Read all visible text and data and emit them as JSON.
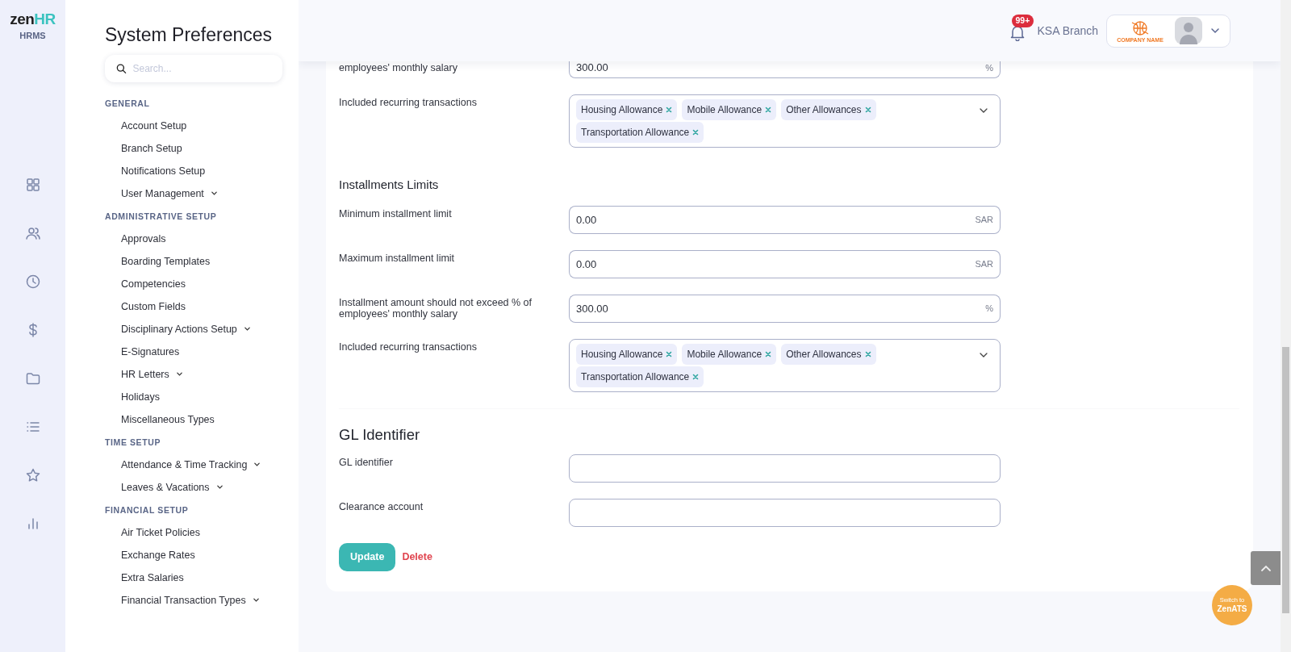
{
  "logo": {
    "parts": [
      {
        "text": "zen",
        "color": "#1f1f1f"
      },
      {
        "text": "HR",
        "color": "#3cc3c0"
      }
    ],
    "subtitle": "HRMS"
  },
  "rail": {
    "items": [
      {
        "kind": "grid"
      },
      {
        "kind": "users"
      },
      {
        "kind": "clock"
      },
      {
        "kind": "dollar"
      },
      {
        "kind": "folder"
      },
      {
        "kind": "list"
      },
      {
        "kind": "star"
      },
      {
        "kind": "chart"
      }
    ]
  },
  "sidebar": {
    "title": "System Preferences",
    "search": {
      "placeholder": "Search..."
    },
    "groups": [
      {
        "title": "GENERAL",
        "items": [
          {
            "label": "Account Setup",
            "has_submenu": false
          },
          {
            "label": "Branch Setup",
            "has_submenu": false
          },
          {
            "label": "Notifications Setup",
            "has_submenu": false
          },
          {
            "label": "User Management",
            "has_submenu": true
          }
        ]
      },
      {
        "title": "ADMINISTRATIVE SETUP",
        "items": [
          {
            "label": "Approvals",
            "has_submenu": false
          },
          {
            "label": "Boarding Templates",
            "has_submenu": false
          },
          {
            "label": "Competencies",
            "has_submenu": false
          },
          {
            "label": "Custom Fields",
            "has_submenu": false
          },
          {
            "label": "Disciplinary Actions Setup",
            "has_submenu": true
          },
          {
            "label": "E-Signatures",
            "has_submenu": false
          },
          {
            "label": "HR Letters",
            "has_submenu": true
          },
          {
            "label": "Holidays",
            "has_submenu": false
          },
          {
            "label": "Miscellaneous Types",
            "has_submenu": false
          }
        ]
      },
      {
        "title": "TIME SETUP",
        "items": [
          {
            "label": "Attendance & Time Tracking",
            "has_submenu": true
          },
          {
            "label": "Leaves & Vacations",
            "has_submenu": true
          }
        ]
      },
      {
        "title": "FINANCIAL SETUP",
        "items": [
          {
            "label": "Air Ticket Policies",
            "has_submenu": false
          },
          {
            "label": "Exchange Rates",
            "has_submenu": false
          },
          {
            "label": "Extra Salaries",
            "has_submenu": false
          },
          {
            "label": "Financial Transaction Types",
            "has_submenu": true
          }
        ]
      }
    ]
  },
  "header": {
    "notification_count": "99+",
    "branch": "KSA Branch",
    "company_logo_text": "COMPANY NAME"
  },
  "form": {
    "sections": [
      {
        "rows": [
          {
            "label": "employees' monthly salary",
            "kind": "input",
            "value": "300.00",
            "suffix": "%"
          },
          {
            "label": "Included recurring transactions",
            "kind": "tags",
            "tags": [
              "Housing Allowance",
              "Mobile Allowance",
              "Other Allowances",
              "Transportation Allowance"
            ]
          }
        ]
      },
      {
        "heading": "Installments Limits",
        "rows": [
          {
            "label": "Minimum installment limit",
            "kind": "input",
            "value": "0.00",
            "suffix": "SAR"
          },
          {
            "label": "Maximum installment limit",
            "kind": "input",
            "value": "0.00",
            "suffix": "SAR"
          },
          {
            "label": "Installment amount should not exceed % of employees' monthly salary",
            "kind": "input",
            "value": "300.00",
            "suffix": "%"
          },
          {
            "label": "Included recurring transactions",
            "kind": "tags",
            "tags": [
              "Housing Allowance",
              "Mobile Allowance",
              "Other Allowances",
              "Transportation Allowance"
            ]
          }
        ]
      },
      {
        "heading": "GL Identifier",
        "divided": true,
        "rows": [
          {
            "label": "GL identifier",
            "kind": "input"
          },
          {
            "label": "Clearance account",
            "kind": "input"
          }
        ]
      }
    ],
    "buttons": [
      {
        "label": "Update",
        "kind": "primary"
      },
      {
        "label": "Delete",
        "kind": "danger"
      }
    ]
  },
  "switch_button": {
    "line_1": "Switch to",
    "line_2": "ZenATS"
  }
}
